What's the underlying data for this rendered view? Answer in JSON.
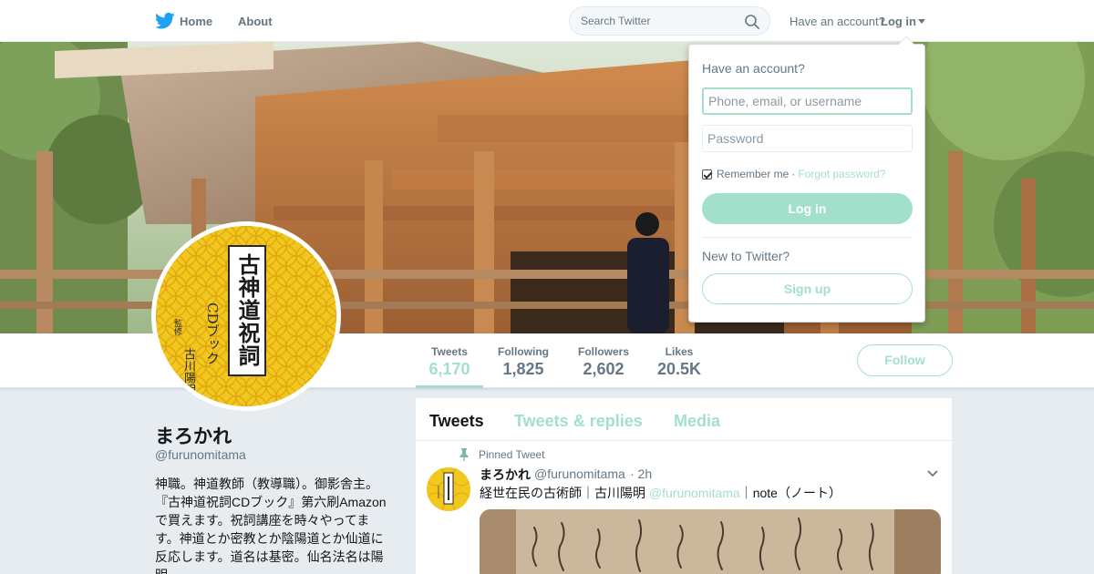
{
  "nav": {
    "home_label": "Home",
    "about_label": "About",
    "search_placeholder": "Search Twitter",
    "have_account": "Have an account?",
    "login_label": "Log in"
  },
  "profile": {
    "name": "まろかれ",
    "handle": "@furunomitama",
    "bio": "神職。神道教師（教導職）。御影舎主。『古神道祝詞CDブック』第六刷Amazonで買えます。祝詞講座を時々やってます。神道とか密教とか陰陽道とか仙道に反応します。道名は基密。仙名法名は陽明。",
    "follow_label": "Follow",
    "avatar_book": {
      "title": "古神道祝詞",
      "subtitle": "CDブック",
      "author": "古川陽明",
      "editor": "監修"
    }
  },
  "stats": [
    {
      "label": "Tweets",
      "value": "6,170"
    },
    {
      "label": "Following",
      "value": "1,825"
    },
    {
      "label": "Followers",
      "value": "2,602"
    },
    {
      "label": "Likes",
      "value": "20.5K"
    }
  ],
  "timeline": {
    "tabs": [
      "Tweets",
      "Tweets & replies",
      "Media"
    ],
    "pinned_label": "Pinned Tweet",
    "tweet": {
      "name": "まろかれ",
      "handle": "@furunomitama",
      "time": "· 2h",
      "text_before": "経世在民の古術師｜古川陽明 ",
      "mention": "@furunomitama",
      "text_after": "｜note（ノート）"
    }
  },
  "login_dropdown": {
    "title": "Have an account?",
    "username_placeholder": "Phone, email, or username",
    "password_placeholder": "Password",
    "remember_label": "Remember me",
    "separator": "·",
    "forgot_label": "Forgot password?",
    "login_button": "Log in",
    "new_label": "New to Twitter?",
    "signup_button": "Sign up"
  },
  "colors": {
    "accent": "#a3e0cc",
    "bird": "#1da1f2",
    "avatar_yellow": "#f2c81e"
  }
}
